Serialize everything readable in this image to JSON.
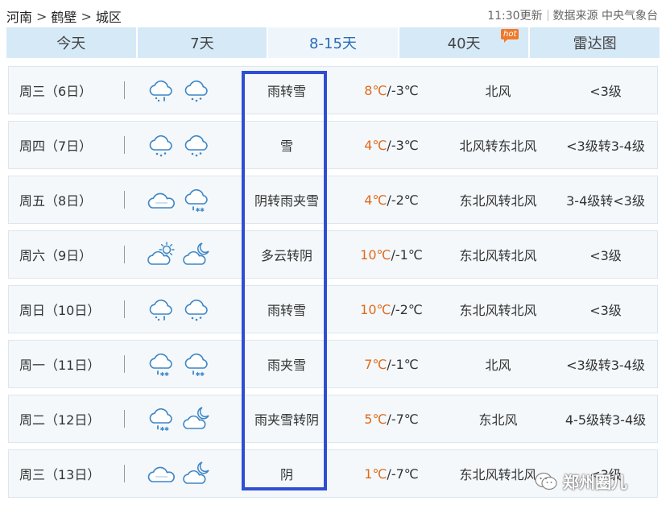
{
  "breadcrumb": {
    "province": "河南",
    "city": "鹤壁",
    "district": "城区",
    "separator": ">"
  },
  "meta": {
    "updated": "11:30更新",
    "source": "数据来源 中央气象台"
  },
  "tabs": [
    {
      "label": "今天",
      "active": false
    },
    {
      "label": "7天",
      "active": false
    },
    {
      "label": "8-15天",
      "active": true
    },
    {
      "label": "40天",
      "active": false,
      "badge": "hot"
    },
    {
      "label": "雷达图",
      "active": false
    }
  ],
  "forecast": [
    {
      "day": "周三（6日）",
      "icons": [
        "rain-snow-icon",
        "snow-icon"
      ],
      "desc": "雨转雪",
      "high": "8℃",
      "low": "-3℃",
      "wind": "北风",
      "level": "<3级"
    },
    {
      "day": "周四（7日）",
      "icons": [
        "snow-icon",
        "snow-icon"
      ],
      "desc": "雪",
      "high": "4℃",
      "low": "-3℃",
      "wind": "北风转东北风",
      "level": "<3级转3-4级"
    },
    {
      "day": "周五（8日）",
      "icons": [
        "cloudy-icon",
        "sleet-icon"
      ],
      "desc": "阴转雨夹雪",
      "high": "4℃",
      "low": "-2℃",
      "wind": "东北风转北风",
      "level": "3-4级转<3级"
    },
    {
      "day": "周六（9日）",
      "icons": [
        "partly-cloudy-day-icon",
        "partly-cloudy-night-icon"
      ],
      "desc": "多云转阴",
      "high": "10℃",
      "low": "-1℃",
      "wind": "东北风转北风",
      "level": "<3级"
    },
    {
      "day": "周日（10日）",
      "icons": [
        "rain-snow-icon",
        "snow-icon"
      ],
      "desc": "雨转雪",
      "high": "10℃",
      "low": "-2℃",
      "wind": "东北风转北风",
      "level": "<3级"
    },
    {
      "day": "周一（11日）",
      "icons": [
        "sleet-icon",
        "sleet-icon"
      ],
      "desc": "雨夹雪",
      "high": "7℃",
      "low": "-1℃",
      "wind": "北风",
      "level": "<3级转3-4级"
    },
    {
      "day": "周二（12日）",
      "icons": [
        "sleet-icon",
        "partly-cloudy-night-icon"
      ],
      "desc": "雨夹雪转阴",
      "high": "5℃",
      "low": "-7℃",
      "wind": "东北风",
      "level": "4-5级转3-4级"
    },
    {
      "day": "周三（13日）",
      "icons": [
        "cloudy-icon",
        "partly-cloudy-night-icon"
      ],
      "desc": "阴",
      "high": "1℃",
      "low": "-7℃",
      "wind": "东北风转北风",
      "level": "<3级"
    }
  ],
  "watermark": "郑州圈儿",
  "colors": {
    "tab_bg": "#d6e9f7",
    "tab_active_bg": "#eef6fc",
    "tab_active_text": "#2a6db5",
    "high_temp": "#e06a1c",
    "icon_stroke": "#3d86c6",
    "highlight_box": "#2f4fd2",
    "hot_badge": "#f07a2a"
  }
}
